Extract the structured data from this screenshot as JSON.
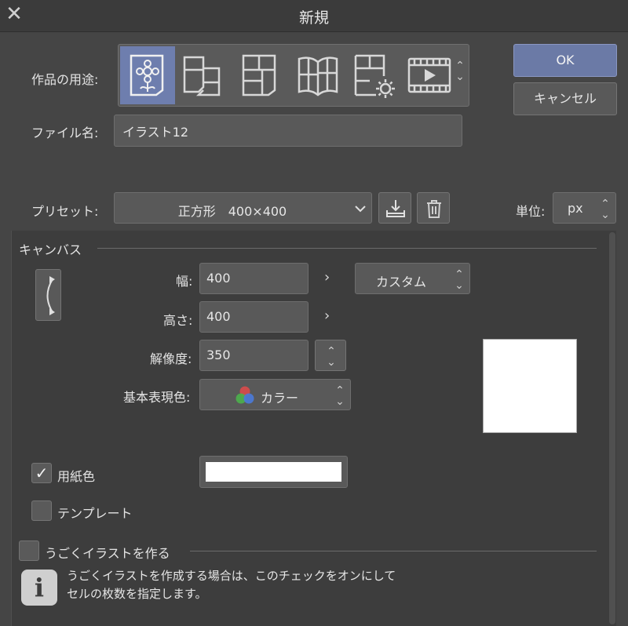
{
  "window": {
    "title": "新規",
    "close_icon": "close-icon"
  },
  "usage": {
    "label": "作品の用途:",
    "items": [
      {
        "icon": "illustration-icon",
        "selected": true
      },
      {
        "icon": "webtoon-icon",
        "selected": false
      },
      {
        "icon": "comic-page-icon",
        "selected": false
      },
      {
        "icon": "book-spread-icon",
        "selected": false
      },
      {
        "icon": "page-settings-icon",
        "selected": false
      },
      {
        "icon": "animation-icon",
        "selected": false
      }
    ]
  },
  "buttons": {
    "ok": "OK",
    "cancel": "キャンセル"
  },
  "file_name": {
    "label": "ファイル名:",
    "value": "イラスト12"
  },
  "preset": {
    "label": "プリセット:",
    "value": "正方形　400×400"
  },
  "unit": {
    "label": "単位:",
    "value": "px"
  },
  "canvas": {
    "section_label": "キャンバス",
    "width": {
      "label": "幅:",
      "value": "400"
    },
    "height": {
      "label": "高さ:",
      "value": "400"
    },
    "size_preset": "カスタム",
    "resolution": {
      "label": "解像度:",
      "value": "350"
    },
    "color_mode": {
      "label": "基本表現色:",
      "value": "カラー"
    },
    "paper_color": {
      "label": "用紙色",
      "checked": true,
      "swatch": "#ffffff"
    },
    "template": {
      "label": "テンプレート",
      "checked": false
    },
    "preview_color": "#ffffff"
  },
  "animation": {
    "label": "うごくイラストを作る",
    "checked": false,
    "info_icon": "info-icon",
    "info_line1": "うごくイラストを作成する場合は、このチェックをオンにして",
    "info_line2": "セルの枚数を指定します。"
  },
  "colors": {
    "accent": "#6b7aa6",
    "background": "#454545",
    "panel": "#3d3d3d"
  }
}
